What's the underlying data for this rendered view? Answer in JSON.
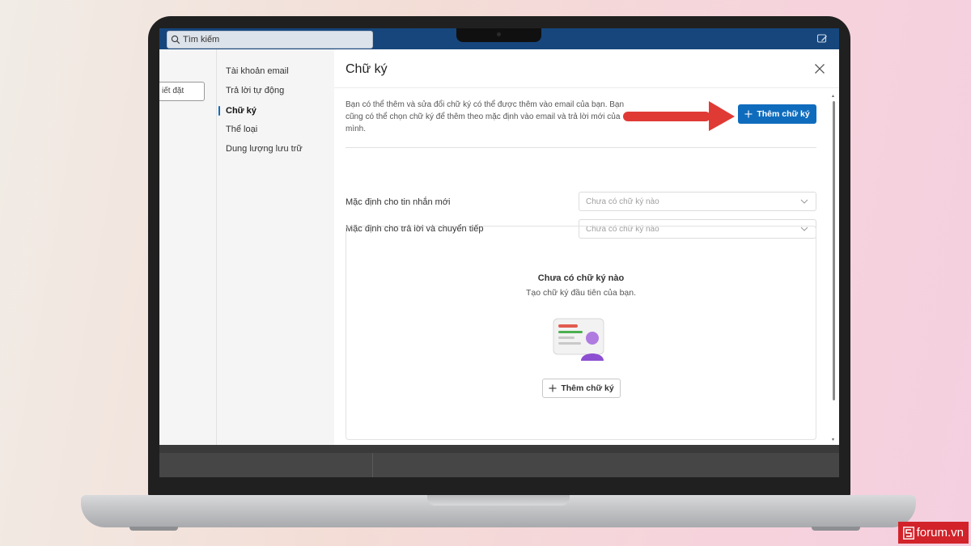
{
  "topbar": {
    "search_label": "Tìm kiếm"
  },
  "settings_left": {
    "partial_label": "iết đặt"
  },
  "nav": {
    "items": [
      {
        "label": "Tài khoản email",
        "active": false
      },
      {
        "label": "Trả lời tự động",
        "active": false
      },
      {
        "label": "Chữ ký",
        "active": true
      },
      {
        "label": "Thể loại",
        "active": false
      },
      {
        "label": "Dung lượng lưu trữ",
        "active": false
      }
    ]
  },
  "panel": {
    "title": "Chữ ký",
    "description": "Bạn có thể thêm và sửa đổi chữ ký có thể được thêm vào email của bạn. Bạn cũng có thể chọn chữ ký để thêm theo mặc định vào email và trả lời mới của mình.",
    "add_button_label": "Thêm chữ ký",
    "defaults": [
      {
        "label": "Mặc định cho tin nhắn mới",
        "placeholder": "Chưa có chữ ký nào"
      },
      {
        "label": "Mặc định cho trả lời và chuyển tiếp",
        "placeholder": "Chưa có chữ ký nào"
      }
    ],
    "empty_state": {
      "title": "Chưa có chữ ký nào",
      "subtitle": "Tạo chữ ký đầu tiên của bạn.",
      "button_label": "Thêm chữ ký"
    }
  },
  "watermark": {
    "text": "forum.vn"
  },
  "colors": {
    "accent": "#0f6cbd",
    "topbar": "#16467c",
    "arrow": "#e03a35",
    "watermark": "#d2232a"
  },
  "icons": [
    "search-icon",
    "compose-icon",
    "close-icon",
    "plus-icon",
    "chevron-down-icon",
    "signature-illustration-icon",
    "red-arrow-icon"
  ]
}
